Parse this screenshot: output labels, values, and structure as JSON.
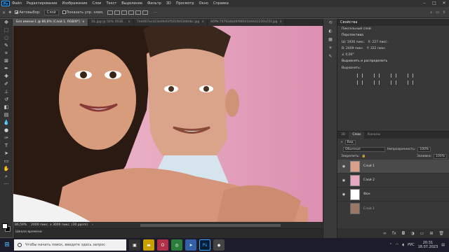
{
  "app": {
    "logo": "Ps"
  },
  "menu": [
    "Файл",
    "Редактирование",
    "Изображение",
    "Слои",
    "Текст",
    "Выделение",
    "Фильтр",
    "3D",
    "Просмотр",
    "Окно",
    "Справка"
  ],
  "options": {
    "autoselect_label": "Автовыбор:",
    "autoselect_value": "Слой",
    "transform_label": "Показать упр. элем."
  },
  "tabs": [
    {
      "label": "Без имени-1 @ 86,6% (Слой 1, RGB/8*)",
      "active": true
    },
    {
      "label": "1lL.jpg @ 50% (RGB...",
      "active": false
    },
    {
      "label": "7ed467ecd23e0fe93f581fb9348dbc.jpg",
      "active": false
    },
    {
      "label": "66f9c797934b06f980d1b9442230a55f.jpg",
      "active": false
    }
  ],
  "status": {
    "zoom": "86,59%",
    "doc_size": "2000 пикс. x 3000 пикс. (30 ppcm)"
  },
  "timeline": {
    "label": "Шкала времени"
  },
  "properties": {
    "title": "Свойства",
    "kind": "Пиксельный слой",
    "transform_title": "Перспектива",
    "w_label": "Ш:",
    "w_value": "1926 пикс.",
    "h_label": "В:",
    "h_value": "2409 пикс.",
    "x_label": "X:",
    "x_value": "227 пикс.",
    "y_label": "Y:",
    "y_value": "322 пикс.",
    "angle": "0,00°",
    "align_title": "Выровнять и распределить",
    "align_sub": "Выровнять:"
  },
  "layers": {
    "tabs": [
      "3D",
      "Слои",
      "Каналы"
    ],
    "active_tab": "Слои",
    "kind_label": "Вид",
    "blend": "Обычные",
    "opacity_label": "Непрозрачность:",
    "opacity": "100%",
    "lock_label": "Закрепить:",
    "fill_label": "Заливка:",
    "fill": "100%",
    "items": [
      {
        "name": "Слой 1",
        "selected": true
      },
      {
        "name": "Слой 2",
        "selected": false
      },
      {
        "name": "Фон",
        "selected": false
      }
    ],
    "footer_layer": "Слой 1"
  },
  "taskbar": {
    "search_placeholder": "Чтобы начать поиск, введите здесь запрос",
    "lang": "РУС",
    "time": "20:31",
    "date": "18.07.2023"
  },
  "colors": {
    "ps_blue": "#31a8ff",
    "canvas_bg": "#e6a9bf"
  }
}
